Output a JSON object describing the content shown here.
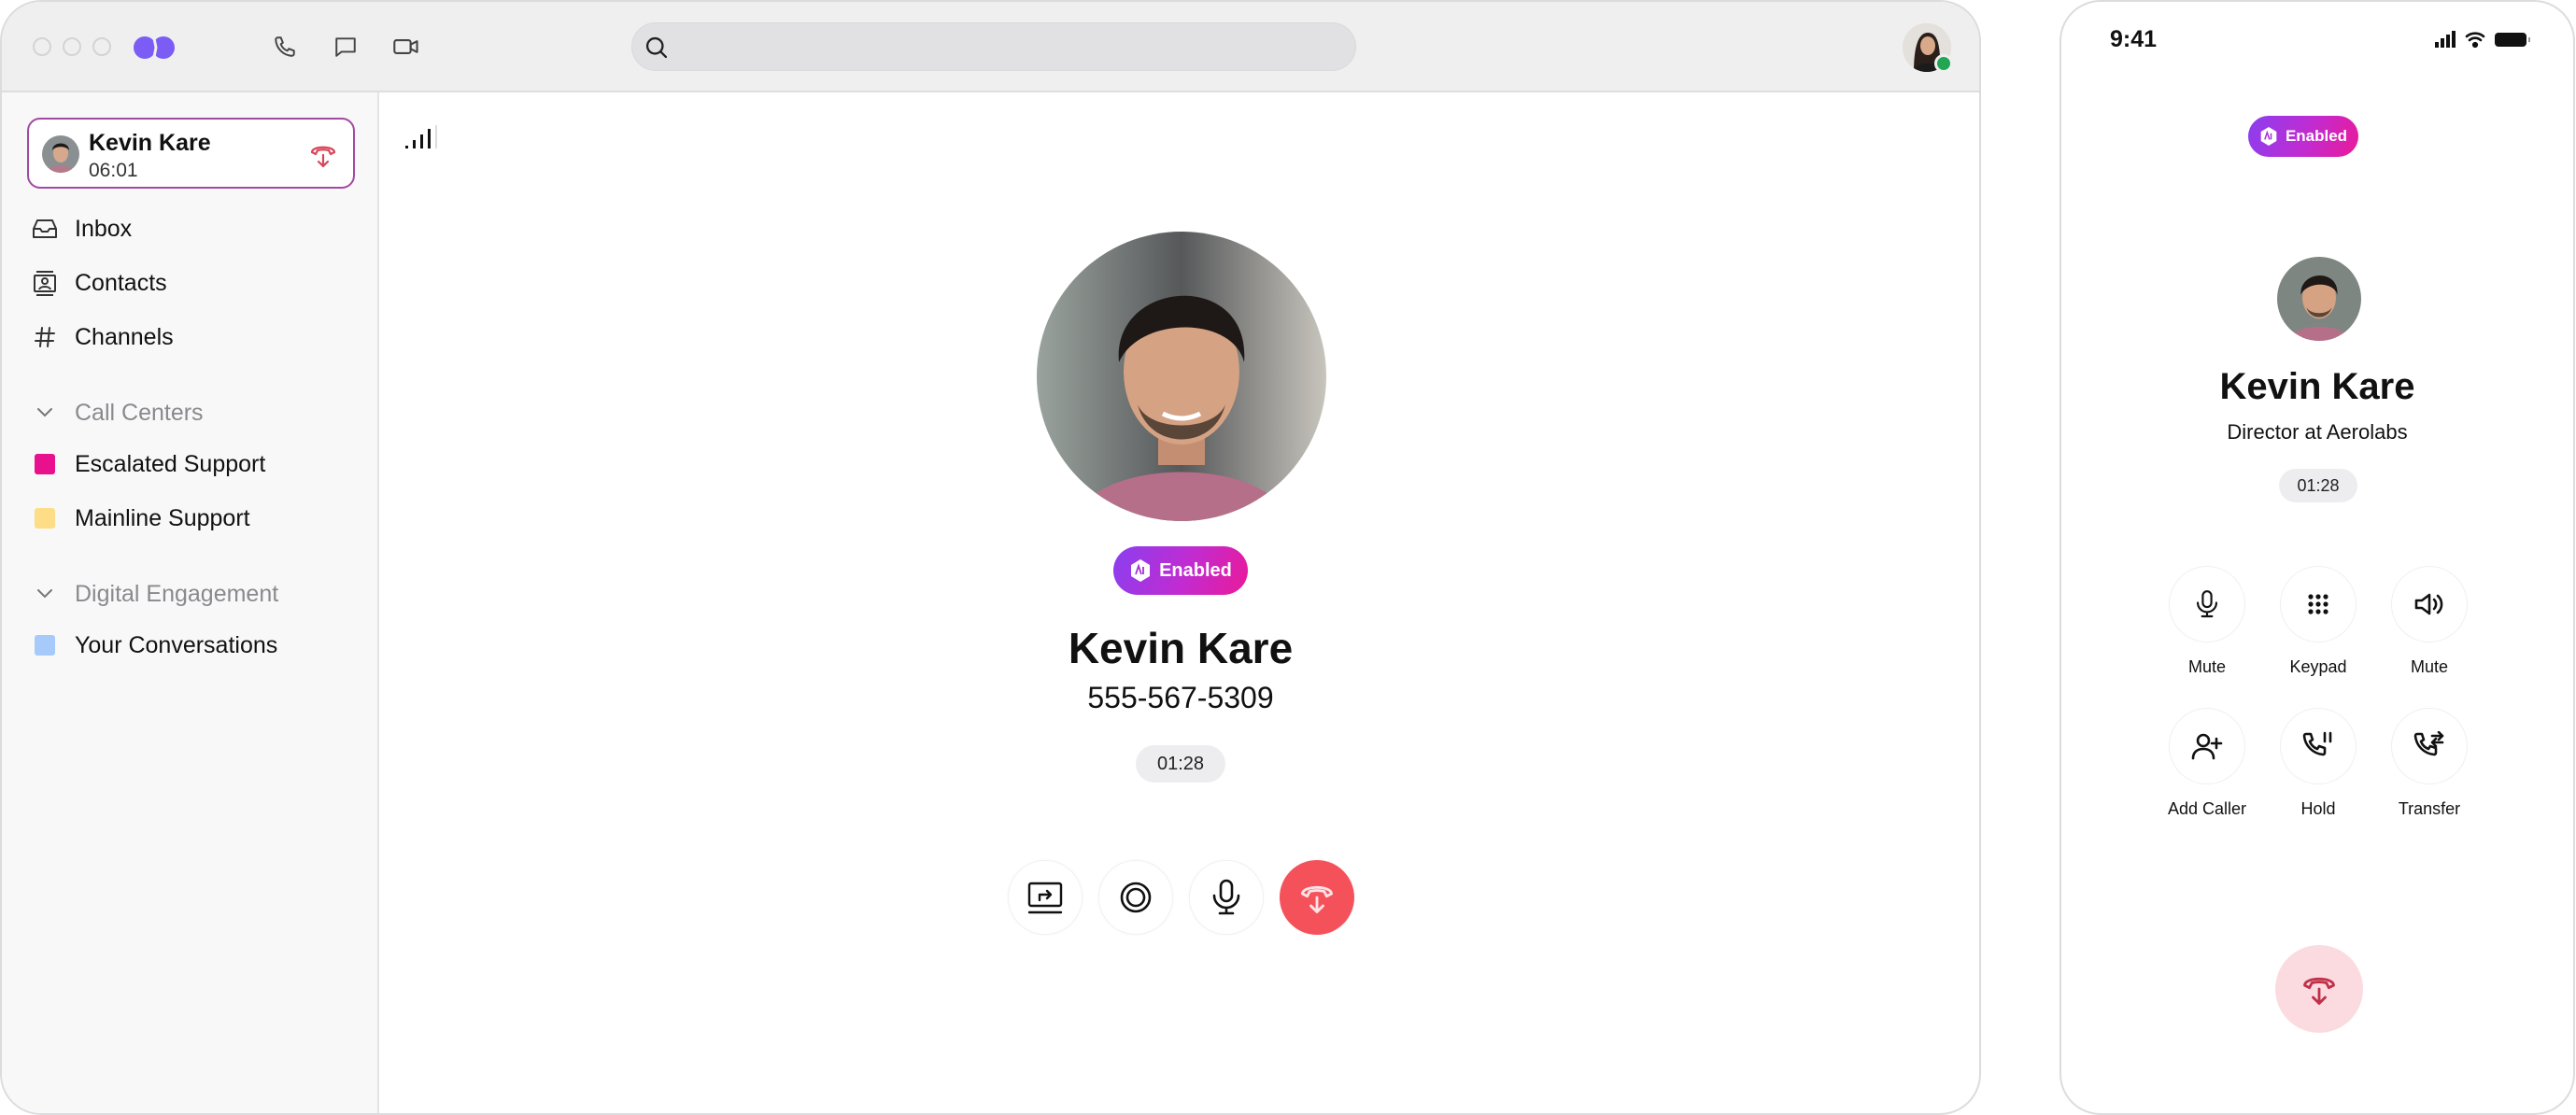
{
  "desktop": {
    "titlebar": {
      "icons": [
        "phone-icon",
        "chat-icon",
        "video-icon"
      ],
      "search": {
        "value": "",
        "placeholder": ""
      }
    },
    "sidebar": {
      "active_call": {
        "name": "Kevin Kare",
        "duration": "06:01"
      },
      "nav": [
        {
          "label": "Inbox",
          "icon": "inbox-icon"
        },
        {
          "label": "Contacts",
          "icon": "contacts-icon"
        },
        {
          "label": "Channels",
          "icon": "hash-icon"
        }
      ],
      "sections": [
        {
          "title": "Call Centers",
          "items": [
            {
              "label": "Escalated Support",
              "color": "#e8108c"
            },
            {
              "label": "Mainline Support",
              "color": "#fddd85"
            }
          ]
        },
        {
          "title": "Digital Engagement",
          "items": [
            {
              "label": "Your Conversations",
              "color": "#a6cbfa"
            }
          ]
        }
      ]
    },
    "call": {
      "badge": "Enabled",
      "name": "Kevin Kare",
      "phone": "555-567-5309",
      "timer": "01:28",
      "controls": [
        "screen-share",
        "record",
        "microphone",
        "end-call"
      ]
    }
  },
  "phone": {
    "status_time": "9:41",
    "badge": "Enabled",
    "name": "Kevin Kare",
    "title": "Director at Aerolabs",
    "timer": "01:28",
    "actions": [
      {
        "label": "Mute",
        "icon": "microphone-icon"
      },
      {
        "label": "Keypad",
        "icon": "keypad-icon"
      },
      {
        "label": "Mute",
        "icon": "speaker-icon"
      },
      {
        "label": "Add Caller",
        "icon": "add-user-icon"
      },
      {
        "label": "Hold",
        "icon": "hold-icon"
      },
      {
        "label": "Transfer",
        "icon": "transfer-icon"
      }
    ]
  },
  "colors": {
    "accent": "#7b5cf5",
    "end_call": "#f5515a",
    "end_call_soft": "#fbdbe0",
    "active_border": "#a24aa2",
    "presence": "#22a652"
  }
}
